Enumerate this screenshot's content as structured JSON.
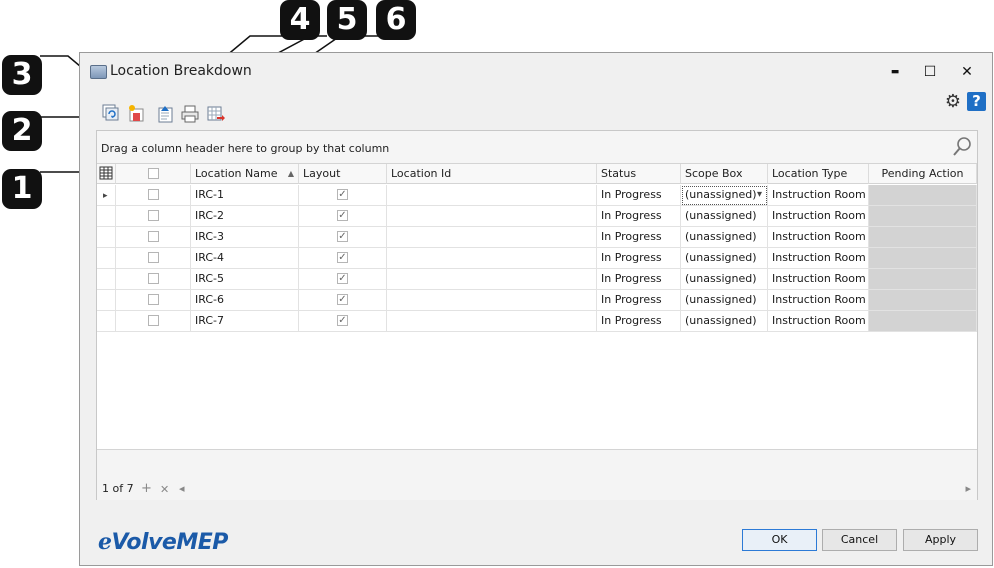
{
  "callouts": [
    "1",
    "2",
    "3",
    "4",
    "5",
    "6"
  ],
  "window": {
    "title": "Location Breakdown",
    "minimize_glyph": "▬",
    "maximize_glyph": "☐",
    "close_glyph": "✕"
  },
  "toolbar": {
    "icons": [
      "refresh-icon",
      "new-location-icon",
      "import-icon",
      "print-icon",
      "export-icon"
    ]
  },
  "help_glyph": "?",
  "grid": {
    "group_panel_text": "Drag a column header here to group by that column",
    "columns": [
      "Location Name",
      "Layout",
      "Location Id",
      "Status",
      "Scope Box",
      "Location Type",
      "Pending Action"
    ],
    "sort_indicator": "▲",
    "rows": [
      {
        "name": "IRC-1",
        "layout": true,
        "location_id": "",
        "status": "In Progress",
        "scope_box": "(unassigned)",
        "location_type": "Instruction Room",
        "pending_action": ""
      },
      {
        "name": "IRC-2",
        "layout": true,
        "location_id": "",
        "status": "In Progress",
        "scope_box": "(unassigned)",
        "location_type": "Instruction Room",
        "pending_action": ""
      },
      {
        "name": "IRC-3",
        "layout": true,
        "location_id": "",
        "status": "In Progress",
        "scope_box": "(unassigned)",
        "location_type": "Instruction Room",
        "pending_action": ""
      },
      {
        "name": "IRC-4",
        "layout": true,
        "location_id": "",
        "status": "In Progress",
        "scope_box": "(unassigned)",
        "location_type": "Instruction Room",
        "pending_action": ""
      },
      {
        "name": "IRC-5",
        "layout": true,
        "location_id": "",
        "status": "In Progress",
        "scope_box": "(unassigned)",
        "location_type": "Instruction Room",
        "pending_action": ""
      },
      {
        "name": "IRC-6",
        "layout": true,
        "location_id": "",
        "status": "In Progress",
        "scope_box": "(unassigned)",
        "location_type": "Instruction Room",
        "pending_action": ""
      },
      {
        "name": "IRC-7",
        "layout": true,
        "location_id": "",
        "status": "In Progress",
        "scope_box": "(unassigned)",
        "location_type": "Instruction Room",
        "pending_action": ""
      }
    ],
    "dropdown_glyph": "▾",
    "row_indicator": "▸",
    "check_glyph": "✓"
  },
  "navigator": {
    "record_text": "1 of 7",
    "add_glyph": "+",
    "delete_glyph": "✕",
    "scroll_left_glyph": "◂",
    "scroll_right_glyph": "▸"
  },
  "footer": {
    "logo_prefix": "e",
    "logo_text": "VolveMEP",
    "ok_label": "OK",
    "cancel_label": "Cancel",
    "apply_label": "Apply"
  },
  "colors": {
    "accent": "#1f6fc5",
    "logo": "#1b5aa8",
    "pending_cell": "#d3d3d3"
  }
}
